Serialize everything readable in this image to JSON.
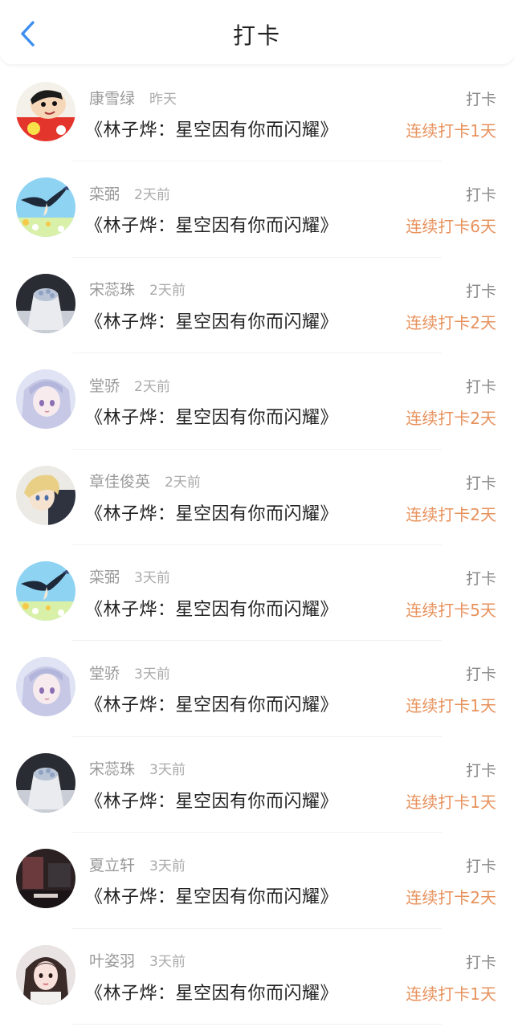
{
  "header": {
    "title": "打卡",
    "back_icon": "chevron-left-icon",
    "accent_color": "#3d8ef0"
  },
  "colors": {
    "streak": "#e7915b",
    "muted": "#999999"
  },
  "items": [
    {
      "name": "康雪绿",
      "time": "昨天",
      "book": "《林子烨：星空因有你而闪耀》",
      "action": "打卡",
      "streak": "连续打卡1天",
      "avatar": "avatar-cartoon-red"
    },
    {
      "name": "栾弼",
      "time": "2天前",
      "book": "《林子烨：星空因有你而闪耀》",
      "action": "打卡",
      "streak": "连续打卡6天",
      "avatar": "avatar-swallow-sky"
    },
    {
      "name": "宋蕊珠",
      "time": "2天前",
      "book": "《林子烨：星空因有你而闪耀》",
      "action": "打卡",
      "streak": "连续打卡2天",
      "avatar": "avatar-dessert"
    },
    {
      "name": "堂骄",
      "time": "2天前",
      "book": "《林子烨：星空因有你而闪耀》",
      "action": "打卡",
      "streak": "连续打卡2天",
      "avatar": "avatar-anime-girl"
    },
    {
      "name": "章佳俊英",
      "time": "2天前",
      "book": "《林子烨：星空因有你而闪耀》",
      "action": "打卡",
      "streak": "连续打卡2天",
      "avatar": "avatar-anime-blond"
    },
    {
      "name": "栾弼",
      "time": "3天前",
      "book": "《林子烨：星空因有你而闪耀》",
      "action": "打卡",
      "streak": "连续打卡5天",
      "avatar": "avatar-swallow-sky"
    },
    {
      "name": "堂骄",
      "time": "3天前",
      "book": "《林子烨：星空因有你而闪耀》",
      "action": "打卡",
      "streak": "连续打卡1天",
      "avatar": "avatar-anime-girl"
    },
    {
      "name": "宋蕊珠",
      "time": "3天前",
      "book": "《林子烨：星空因有你而闪耀》",
      "action": "打卡",
      "streak": "连续打卡1天",
      "avatar": "avatar-dessert"
    },
    {
      "name": "夏立轩",
      "time": "3天前",
      "book": "《林子烨：星空因有你而闪耀》",
      "action": "打卡",
      "streak": "连续打卡2天",
      "avatar": "avatar-dark-photo"
    },
    {
      "name": "叶姿羽",
      "time": "3天前",
      "book": "《林子烨：星空因有你而闪耀》",
      "action": "打卡",
      "streak": "连续打卡1天",
      "avatar": "avatar-girl-photo"
    }
  ]
}
